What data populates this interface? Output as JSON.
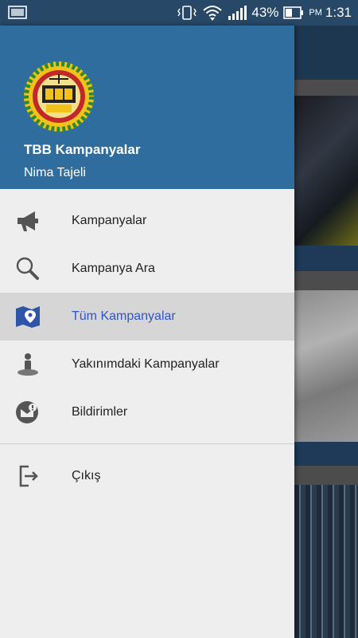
{
  "status_bar": {
    "battery_percent": "43%",
    "ampm": "PM",
    "time": "1:31",
    "icons": [
      "screenshot-icon",
      "vibrate-icon",
      "wifi-icon",
      "signal-icon",
      "battery-icon"
    ]
  },
  "drawer": {
    "header": {
      "app_title": "TBB Kampanyalar",
      "user_name": "Nima Tajeli",
      "logo_icon": "tbb-logo-icon",
      "background_color": "#2f6d9e"
    },
    "items": [
      {
        "label": "Kampanyalar",
        "icon": "megaphone-icon"
      },
      {
        "label": "Kampanya Ara",
        "icon": "search-icon"
      },
      {
        "label": "Tüm Kampanyalar",
        "icon": "map-location-icon",
        "active": true
      },
      {
        "label": "Yakınımdaki Kampanyalar",
        "icon": "nearby-person-icon"
      },
      {
        "label": "Bildirimler",
        "icon": "notification-mail-icon"
      }
    ],
    "secondary_items": [
      {
        "label": "Çıkış",
        "icon": "logout-icon"
      }
    ]
  },
  "colors": {
    "accent": "#2f55c4",
    "statusbar": "#274866",
    "drawer_bg": "#eeeeee",
    "active_row": "#d6d6d6"
  }
}
